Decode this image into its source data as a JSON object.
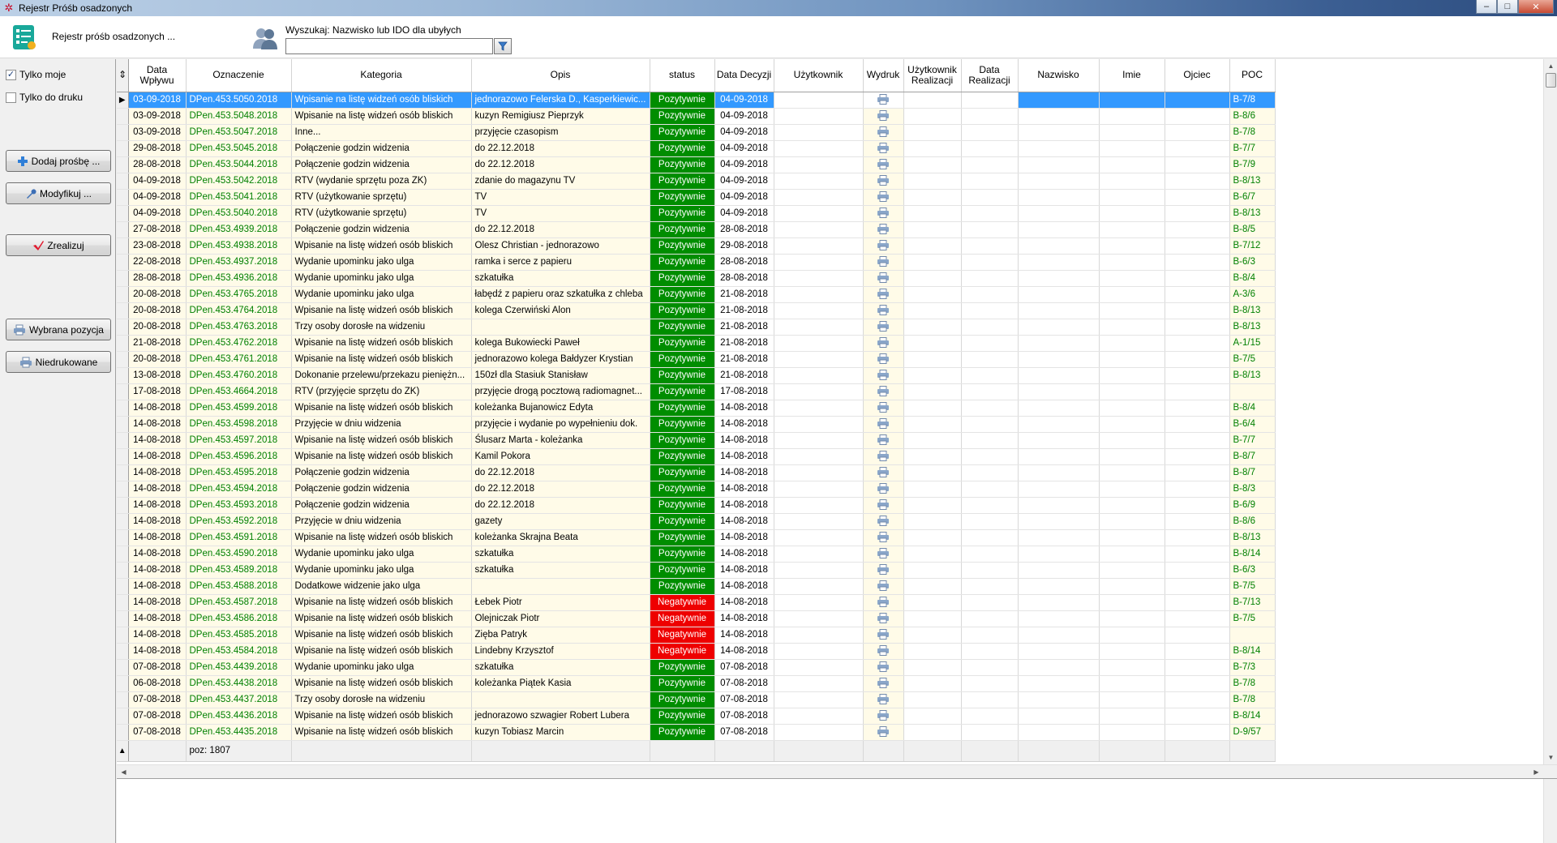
{
  "window": {
    "title": "Rejestr Próśb osadzonych",
    "buttons": {
      "minimize": "–",
      "maximize": "□",
      "close": "✕"
    }
  },
  "toolbar": {
    "title": "Rejestr próśb osadzonych ...",
    "search_label": "Wyszukaj: Nazwisko lub IDO dla ubyłych",
    "search_value": ""
  },
  "sidebar": {
    "checkboxes": [
      {
        "label": "Tylko moje",
        "checked": true
      },
      {
        "label": "Tylko do druku",
        "checked": false
      }
    ],
    "buttons": {
      "add": "Dodaj prośbę ...",
      "modify": "Modyfikuj ...",
      "realize": "Zrealizuj",
      "selected": "Wybrana pozycja",
      "unprinted": "Niedrukowane"
    }
  },
  "grid": {
    "columns": [
      "Data Wpływu",
      "Oznaczenie",
      "Kategoria",
      "Opis",
      "status",
      "Data Decyzji",
      "Użytkownik",
      "Wydruk",
      "Użytkownik Realizacji",
      "Data Realizacji",
      "Nazwisko",
      "Imie",
      "Ojciec",
      "POC"
    ],
    "rows": [
      {
        "d": "03-09-2018",
        "o": "DPen.453.5050.2018",
        "k": "Wpisanie na listę widzeń osób bliskich",
        "op": "jednorazowo Felerska D., Kasperkiewic...",
        "s": "Pozytywnie",
        "dd": "04-09-2018",
        "poc": "B-7/8"
      },
      {
        "d": "03-09-2018",
        "o": "DPen.453.5048.2018",
        "k": "Wpisanie na listę widzeń osób bliskich",
        "op": "kuzyn Remigiusz Pieprzyk",
        "s": "Pozytywnie",
        "dd": "04-09-2018",
        "poc": "B-8/6"
      },
      {
        "d": "03-09-2018",
        "o": "DPen.453.5047.2018",
        "k": "Inne...",
        "op": "przyjęcie czasopism",
        "s": "Pozytywnie",
        "dd": "04-09-2018",
        "poc": "B-7/8"
      },
      {
        "d": "29-08-2018",
        "o": "DPen.453.5045.2018",
        "k": "Połączenie godzin widzenia",
        "op": "do 22.12.2018",
        "s": "Pozytywnie",
        "dd": "04-09-2018",
        "poc": "B-7/7"
      },
      {
        "d": "28-08-2018",
        "o": "DPen.453.5044.2018",
        "k": "Połączenie godzin widzenia",
        "op": "do 22.12.2018",
        "s": "Pozytywnie",
        "dd": "04-09-2018",
        "poc": "B-7/9"
      },
      {
        "d": "04-09-2018",
        "o": "DPen.453.5042.2018",
        "k": "RTV (wydanie sprzętu poza ZK)",
        "op": "zdanie do magazynu TV",
        "s": "Pozytywnie",
        "dd": "04-09-2018",
        "poc": "B-8/13"
      },
      {
        "d": "04-09-2018",
        "o": "DPen.453.5041.2018",
        "k": "RTV (użytkowanie sprzętu)",
        "op": "TV",
        "s": "Pozytywnie",
        "dd": "04-09-2018",
        "poc": "B-6/7"
      },
      {
        "d": "04-09-2018",
        "o": "DPen.453.5040.2018",
        "k": "RTV (użytkowanie sprzętu)",
        "op": "TV",
        "s": "Pozytywnie",
        "dd": "04-09-2018",
        "poc": "B-8/13"
      },
      {
        "d": "27-08-2018",
        "o": "DPen.453.4939.2018",
        "k": "Połączenie godzin widzenia",
        "op": "do 22.12.2018",
        "s": "Pozytywnie",
        "dd": "28-08-2018",
        "poc": "B-8/5"
      },
      {
        "d": "23-08-2018",
        "o": "DPen.453.4938.2018",
        "k": "Wpisanie na listę widzeń osób bliskich",
        "op": "Olesz Christian - jednorazowo",
        "s": "Pozytywnie",
        "dd": "29-08-2018",
        "poc": "B-7/12"
      },
      {
        "d": "22-08-2018",
        "o": "DPen.453.4937.2018",
        "k": "Wydanie upominku jako ulga",
        "op": "ramka i serce z papieru",
        "s": "Pozytywnie",
        "dd": "28-08-2018",
        "poc": "B-6/3"
      },
      {
        "d": "28-08-2018",
        "o": "DPen.453.4936.2018",
        "k": "Wydanie upominku jako ulga",
        "op": "szkatułka",
        "s": "Pozytywnie",
        "dd": "28-08-2018",
        "poc": "B-8/4"
      },
      {
        "d": "20-08-2018",
        "o": "DPen.453.4765.2018",
        "k": "Wydanie upominku jako ulga",
        "op": "łabędź z papieru oraz szkatułka z chleba",
        "s": "Pozytywnie",
        "dd": "21-08-2018",
        "poc": "A-3/6"
      },
      {
        "d": "20-08-2018",
        "o": "DPen.453.4764.2018",
        "k": "Wpisanie na listę widzeń osób bliskich",
        "op": "kolega Czerwiński Alon",
        "s": "Pozytywnie",
        "dd": "21-08-2018",
        "poc": "B-8/13"
      },
      {
        "d": "20-08-2018",
        "o": "DPen.453.4763.2018",
        "k": "Trzy osoby dorosłe na widzeniu",
        "op": "",
        "s": "Pozytywnie",
        "dd": "21-08-2018",
        "poc": "B-8/13"
      },
      {
        "d": "21-08-2018",
        "o": "DPen.453.4762.2018",
        "k": "Wpisanie na listę widzeń osób bliskich",
        "op": "kolega Bukowiecki Paweł",
        "s": "Pozytywnie",
        "dd": "21-08-2018",
        "poc": "A-1/15"
      },
      {
        "d": "20-08-2018",
        "o": "DPen.453.4761.2018",
        "k": "Wpisanie na listę widzeń osób bliskich",
        "op": "jednorazowo kolega Bałdyzer Krystian",
        "s": "Pozytywnie",
        "dd": "21-08-2018",
        "poc": "B-7/5"
      },
      {
        "d": "13-08-2018",
        "o": "DPen.453.4760.2018",
        "k": "Dokonanie przelewu/przekazu pieniężn...",
        "op": "150zł dla Stasiuk Stanisław",
        "s": "Pozytywnie",
        "dd": "21-08-2018",
        "poc": "B-8/13"
      },
      {
        "d": "17-08-2018",
        "o": "DPen.453.4664.2018",
        "k": "RTV (przyjęcie sprzętu do ZK)",
        "op": "przyjęcie drogą pocztową radiomagnet...",
        "s": "Pozytywnie",
        "dd": "17-08-2018",
        "poc": ""
      },
      {
        "d": "14-08-2018",
        "o": "DPen.453.4599.2018",
        "k": "Wpisanie na listę widzeń osób bliskich",
        "op": "koleżanka Bujanowicz Edyta",
        "s": "Pozytywnie",
        "dd": "14-08-2018",
        "poc": "B-8/4"
      },
      {
        "d": "14-08-2018",
        "o": "DPen.453.4598.2018",
        "k": "Przyjęcie w dniu widzenia",
        "op": "przyjęcie i wydanie po wypełnieniu dok.",
        "s": "Pozytywnie",
        "dd": "14-08-2018",
        "poc": "B-6/4"
      },
      {
        "d": "14-08-2018",
        "o": "DPen.453.4597.2018",
        "k": "Wpisanie na listę widzeń osób bliskich",
        "op": "Ślusarz Marta - koleżanka",
        "s": "Pozytywnie",
        "dd": "14-08-2018",
        "poc": "B-7/7"
      },
      {
        "d": "14-08-2018",
        "o": "DPen.453.4596.2018",
        "k": "Wpisanie na listę widzeń osób bliskich",
        "op": "Kamil Pokora",
        "s": "Pozytywnie",
        "dd": "14-08-2018",
        "poc": "B-8/7"
      },
      {
        "d": "14-08-2018",
        "o": "DPen.453.4595.2018",
        "k": "Połączenie godzin widzenia",
        "op": "do 22.12.2018",
        "s": "Pozytywnie",
        "dd": "14-08-2018",
        "poc": "B-8/7"
      },
      {
        "d": "14-08-2018",
        "o": "DPen.453.4594.2018",
        "k": "Połączenie godzin widzenia",
        "op": "do 22.12.2018",
        "s": "Pozytywnie",
        "dd": "14-08-2018",
        "poc": "B-8/3"
      },
      {
        "d": "14-08-2018",
        "o": "DPen.453.4593.2018",
        "k": "Połączenie godzin widzenia",
        "op": "do 22.12.2018",
        "s": "Pozytywnie",
        "dd": "14-08-2018",
        "poc": "B-6/9"
      },
      {
        "d": "14-08-2018",
        "o": "DPen.453.4592.2018",
        "k": "Przyjęcie w dniu widzenia",
        "op": "gazety",
        "s": "Pozytywnie",
        "dd": "14-08-2018",
        "poc": "B-8/6"
      },
      {
        "d": "14-08-2018",
        "o": "DPen.453.4591.2018",
        "k": "Wpisanie na listę widzeń osób bliskich",
        "op": "koleżanka Skrajna Beata",
        "s": "Pozytywnie",
        "dd": "14-08-2018",
        "poc": "B-8/13"
      },
      {
        "d": "14-08-2018",
        "o": "DPen.453.4590.2018",
        "k": "Wydanie upominku jako ulga",
        "op": "szkatułka",
        "s": "Pozytywnie",
        "dd": "14-08-2018",
        "poc": "B-8/14"
      },
      {
        "d": "14-08-2018",
        "o": "DPen.453.4589.2018",
        "k": "Wydanie upominku jako ulga",
        "op": "szkatułka",
        "s": "Pozytywnie",
        "dd": "14-08-2018",
        "poc": "B-6/3"
      },
      {
        "d": "14-08-2018",
        "o": "DPen.453.4588.2018",
        "k": "Dodatkowe widzenie jako ulga",
        "op": "",
        "s": "Pozytywnie",
        "dd": "14-08-2018",
        "poc": "B-7/5"
      },
      {
        "d": "14-08-2018",
        "o": "DPen.453.4587.2018",
        "k": "Wpisanie na listę widzeń osób bliskich",
        "op": "Łebek Piotr",
        "s": "Negatywnie",
        "dd": "14-08-2018",
        "poc": "B-7/13"
      },
      {
        "d": "14-08-2018",
        "o": "DPen.453.4586.2018",
        "k": "Wpisanie na listę widzeń osób bliskich",
        "op": "Olejniczak Piotr",
        "s": "Negatywnie",
        "dd": "14-08-2018",
        "poc": "B-7/5"
      },
      {
        "d": "14-08-2018",
        "o": "DPen.453.4585.2018",
        "k": "Wpisanie na listę widzeń osób bliskich",
        "op": "Zięba Patryk",
        "s": "Negatywnie",
        "dd": "14-08-2018",
        "poc": ""
      },
      {
        "d": "14-08-2018",
        "o": "DPen.453.4584.2018",
        "k": "Wpisanie na listę widzeń osób bliskich",
        "op": "Lindebny Krzysztof",
        "s": "Negatywnie",
        "dd": "14-08-2018",
        "poc": "B-8/14"
      },
      {
        "d": "07-08-2018",
        "o": "DPen.453.4439.2018",
        "k": "Wydanie upominku jako ulga",
        "op": "szkatułka",
        "s": "Pozytywnie",
        "dd": "07-08-2018",
        "poc": "B-7/3"
      },
      {
        "d": "06-08-2018",
        "o": "DPen.453.4438.2018",
        "k": "Wpisanie na listę widzeń osób bliskich",
        "op": "koleżanka Piątek Kasia",
        "s": "Pozytywnie",
        "dd": "07-08-2018",
        "poc": "B-7/8"
      },
      {
        "d": "07-08-2018",
        "o": "DPen.453.4437.2018",
        "k": "Trzy osoby dorosłe na widzeniu",
        "op": "",
        "s": "Pozytywnie",
        "dd": "07-08-2018",
        "poc": "B-7/8"
      },
      {
        "d": "07-08-2018",
        "o": "DPen.453.4436.2018",
        "k": "Wpisanie na listę widzeń osób bliskich",
        "op": "jednorazowo szwagier Robert Lubera",
        "s": "Pozytywnie",
        "dd": "07-08-2018",
        "poc": "B-8/14"
      },
      {
        "d": "07-08-2018",
        "o": "DPen.453.4435.2018",
        "k": "Wpisanie na listę widzeń osób bliskich",
        "op": "kuzyn Tobiasz Marcin",
        "s": "Pozytywnie",
        "dd": "07-08-2018",
        "poc": "D-9/57"
      }
    ],
    "footer": {
      "position": "poz: 1807"
    }
  },
  "colors": {
    "positive": "#008d00",
    "negative": "#ee0000",
    "selected": "#3399ff",
    "code_text": "#008000"
  },
  "icons": {
    "app": "form-icon",
    "toolbar": "checklist-icon",
    "search": "users-icon",
    "filter": "funnel-icon",
    "print": "printer-icon"
  }
}
